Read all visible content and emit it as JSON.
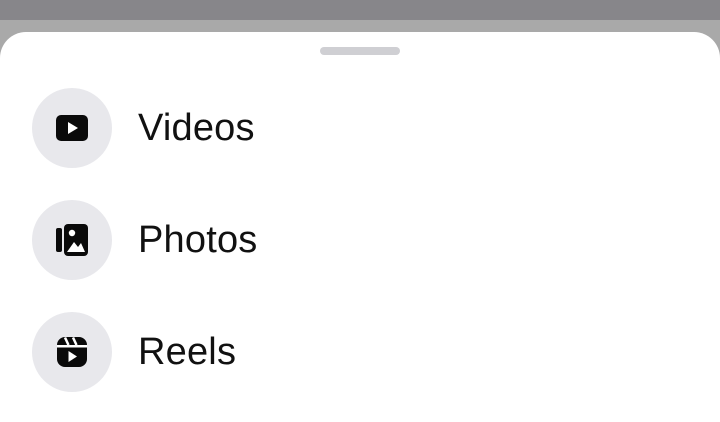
{
  "sheet": {
    "items": [
      {
        "label": "Videos",
        "icon": "video-play-icon"
      },
      {
        "label": "Photos",
        "icon": "photos-icon"
      },
      {
        "label": "Reels",
        "icon": "reels-icon"
      }
    ]
  },
  "colors": {
    "sheet_background": "#ffffff",
    "icon_circle": "#e8e8ec",
    "text": "#111111",
    "scrim": "#a9a9a9",
    "handle": "#cfcfd3"
  }
}
